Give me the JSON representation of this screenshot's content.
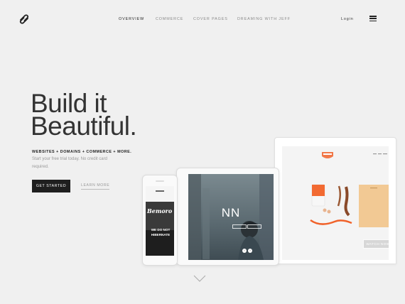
{
  "nav": {
    "items": [
      "Overview",
      "Commerce",
      "Cover Pages",
      "Dreaming with Jeff"
    ],
    "login": "Login"
  },
  "hero": {
    "headline_line1": "Build it",
    "headline_line2": "Beautiful.",
    "tagline": "WEBSITES + DOMAINS + COMMERCE + MORE.",
    "subtext": "Start your free trial today. No credit card required.",
    "cta_primary": "GET STARTED",
    "cta_secondary": "LEARN MORE"
  },
  "devices": {
    "tablet_title": "NN",
    "phone_title": "Bemoro",
    "phone_text": "WE DO NOT HIBERNATE",
    "laptop_watch": "WATCH NOW"
  },
  "colors": {
    "background": "#f0f0f0",
    "button_dark": "#1f1f1f",
    "accent_orange": "#f0622a"
  }
}
